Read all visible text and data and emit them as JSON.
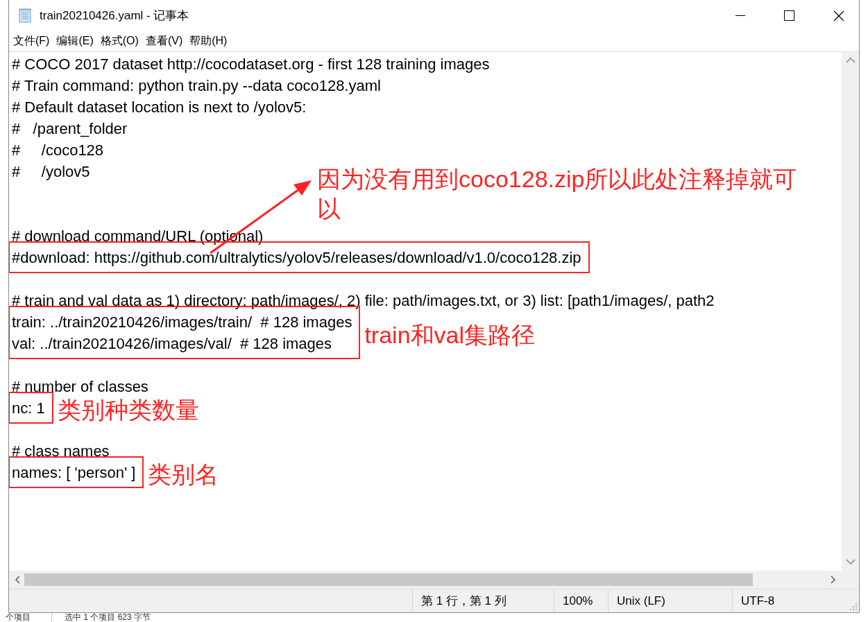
{
  "window": {
    "title": "train20210426.yaml - 记事本"
  },
  "menu": [
    "文件(F)",
    "编辑(E)",
    "格式(O)",
    "查看(V)",
    "帮助(H)"
  ],
  "editor": {
    "blocks": [
      {
        "kind": "plain",
        "lines": [
          "# COCO 2017 dataset http://cocodataset.org - first 128 training images",
          "# Train command: python train.py --data coco128.yaml",
          "# Default dataset location is next to /yolov5:",
          "#   /parent_folder",
          "#     /coco128",
          "#     /yolov5"
        ]
      },
      {
        "kind": "blank"
      },
      {
        "kind": "blank"
      },
      {
        "kind": "plain",
        "lines": [
          "# download command/URL (optional)"
        ]
      },
      {
        "kind": "boxed",
        "lines": [
          "#download: https://github.com/ultralytics/yolov5/releases/download/v1.0/coco128.zip"
        ],
        "note": {
          "kind": "arrow",
          "text": "因为没有用到coco128.zip所以此处注释掉就可以"
        }
      },
      {
        "kind": "blank"
      },
      {
        "kind": "plain",
        "lines": [
          "# train and val data as 1) directory: path/images/, 2) file: path/images.txt, or 3) list: [path1/images/, path2"
        ]
      },
      {
        "kind": "boxed",
        "lines": [
          "train: ../train20210426/images/train/  # 128 images",
          "val: ../train20210426/images/val/  # 128 images"
        ],
        "note": {
          "kind": "beside",
          "text": "train和val集路径"
        }
      },
      {
        "kind": "blank"
      },
      {
        "kind": "plain",
        "lines": [
          "# number of classes"
        ]
      },
      {
        "kind": "boxed",
        "lines": [
          "nc: 1"
        ],
        "note": {
          "kind": "beside",
          "text": "类别种类数量"
        }
      },
      {
        "kind": "blank"
      },
      {
        "kind": "plain",
        "lines": [
          "# class names"
        ]
      },
      {
        "kind": "boxed",
        "lines": [
          "names: [ 'person' ]"
        ],
        "note": {
          "kind": "beside",
          "text": "类别名"
        }
      }
    ]
  },
  "status_bar": {
    "position": "第 1 行，第 1 列",
    "zoom": "100%",
    "line_ending": "Unix (LF)",
    "encoding": "UTF-8"
  },
  "background": {
    "status_items": [
      "个项目",
      "选中 1 个项目 623 字节"
    ]
  }
}
